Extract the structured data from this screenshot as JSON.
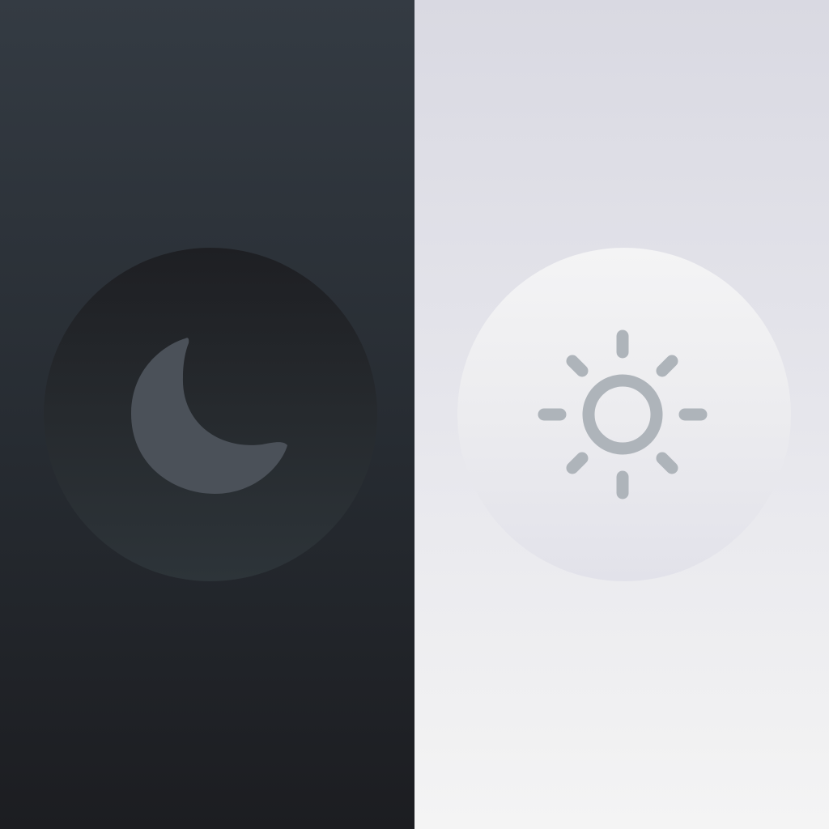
{
  "theme_options": {
    "dark": {
      "icon": "moon-icon",
      "background_color": "#2a2f35",
      "button_color": "#24272c",
      "icon_color": "#4b5159"
    },
    "light": {
      "icon": "sun-icon",
      "background_color": "#e6e6ec",
      "button_color": "#ececef",
      "icon_color": "#aeb4ba"
    }
  }
}
